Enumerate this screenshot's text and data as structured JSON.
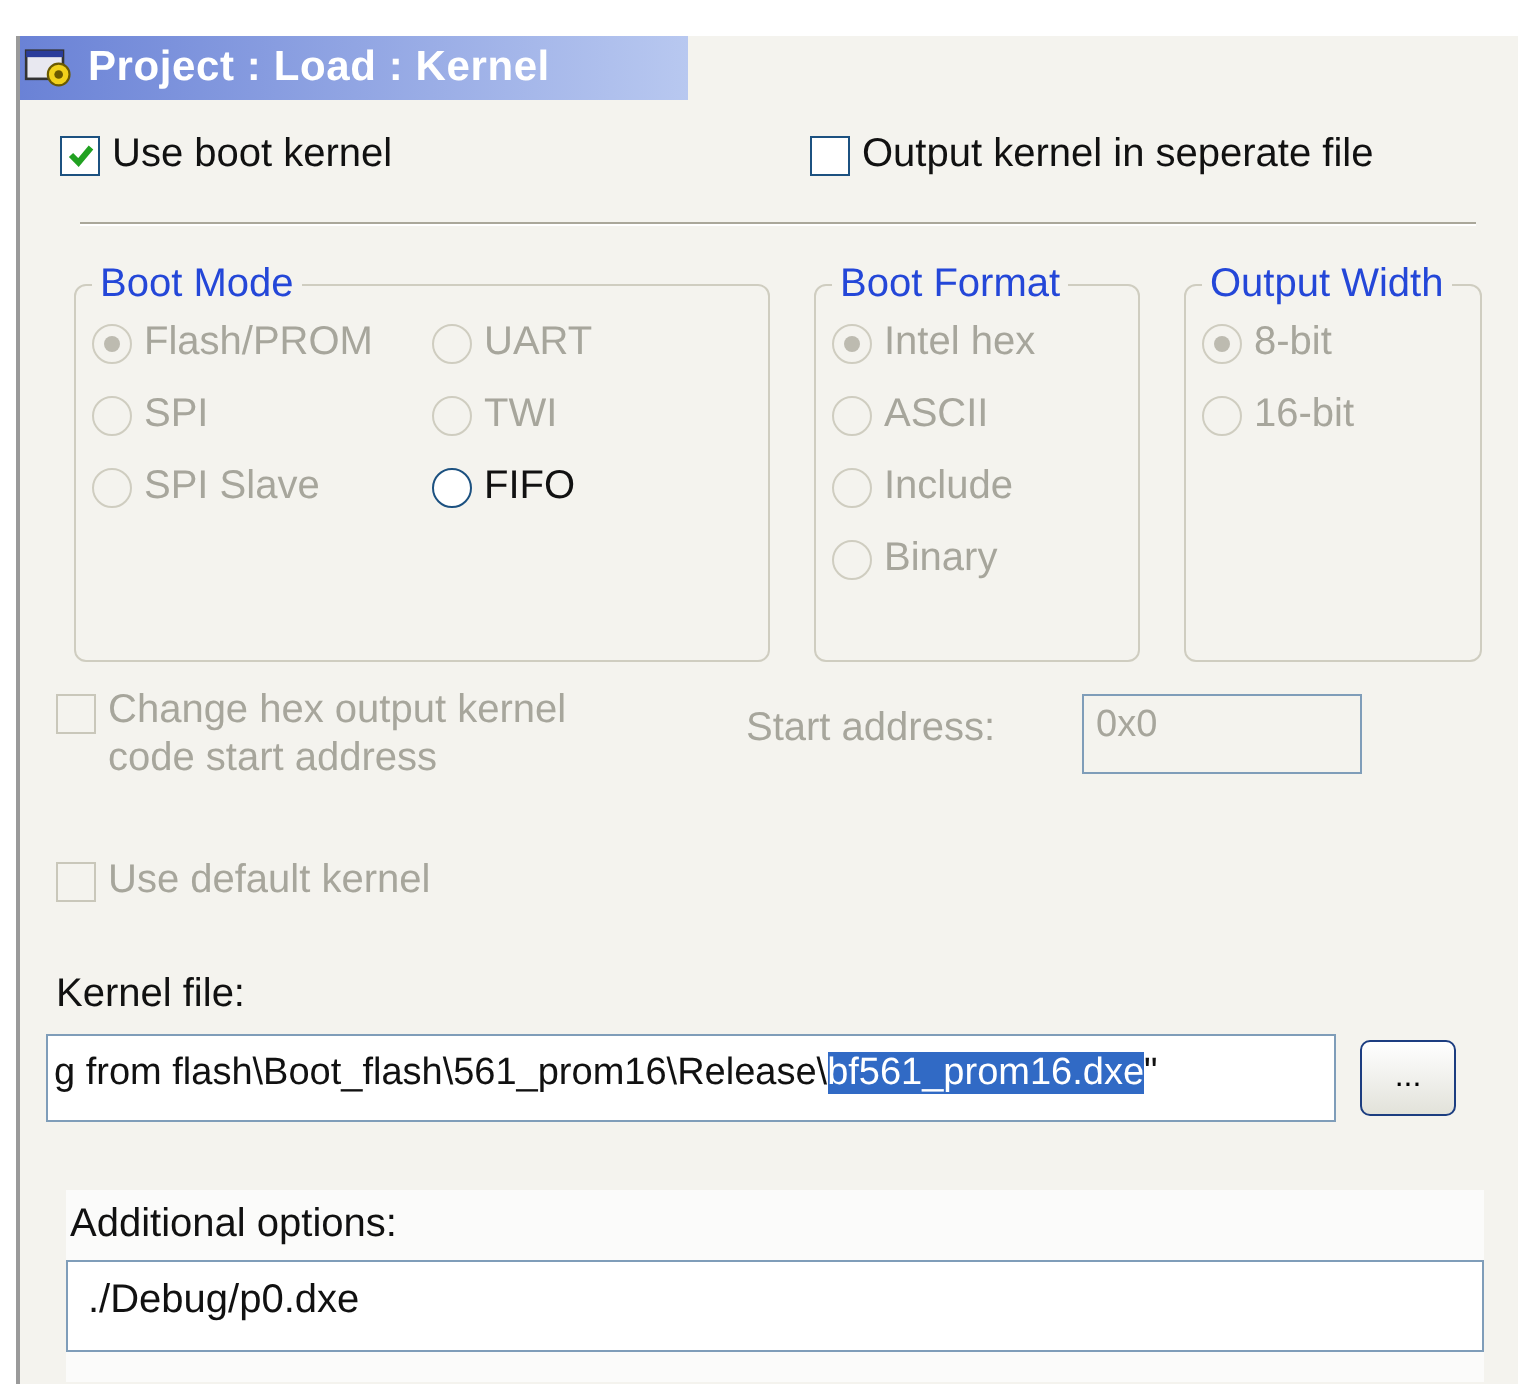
{
  "window": {
    "title": "Project : Load : Kernel"
  },
  "top_options": [
    {
      "label": "Use boot kernel",
      "checked": true,
      "disabled": false
    },
    {
      "label": "Output kernel in seperate file",
      "checked": false,
      "disabled": false
    }
  ],
  "groups": [
    {
      "title": "Boot Mode",
      "kind": "grid",
      "options": [
        {
          "label": "Flash/PROM",
          "selected": true,
          "disabled": true
        },
        {
          "label": "UART",
          "selected": false,
          "disabled": true
        },
        {
          "label": "SPI",
          "selected": false,
          "disabled": true
        },
        {
          "label": "TWI",
          "selected": false,
          "disabled": true
        },
        {
          "label": "SPI Slave",
          "selected": false,
          "disabled": true
        },
        {
          "label": "FIFO",
          "selected": false,
          "disabled": false
        }
      ]
    },
    {
      "title": "Boot Format",
      "kind": "list",
      "options": [
        {
          "label": "Intel hex",
          "selected": true,
          "disabled": true
        },
        {
          "label": "ASCII",
          "selected": false,
          "disabled": true
        },
        {
          "label": "Include",
          "selected": false,
          "disabled": true
        },
        {
          "label": "Binary",
          "selected": false,
          "disabled": true
        }
      ]
    },
    {
      "title": "Output Width",
      "kind": "list",
      "options": [
        {
          "label": "8-bit",
          "selected": true,
          "disabled": true
        },
        {
          "label": "16-bit",
          "selected": false,
          "disabled": true
        }
      ]
    }
  ],
  "change_address": {
    "label": "Change hex output kernel code start address",
    "checked": false,
    "disabled": true
  },
  "start_address": {
    "label": "Start address:",
    "value": "0x0",
    "disabled": true
  },
  "default_kernel": {
    "label": "Use default kernel",
    "checked": false,
    "disabled": true
  },
  "kernel_file": {
    "label": "Kernel file:",
    "value_before": "g from flash\\Boot_flash\\561_prom16\\Release\\",
    "value_selected": "bf561_prom16.dxe",
    "value_after": "\"",
    "browse_button": "..."
  },
  "additional_options": {
    "label": "Additional options:",
    "value": "./Debug/p0.dxe"
  }
}
